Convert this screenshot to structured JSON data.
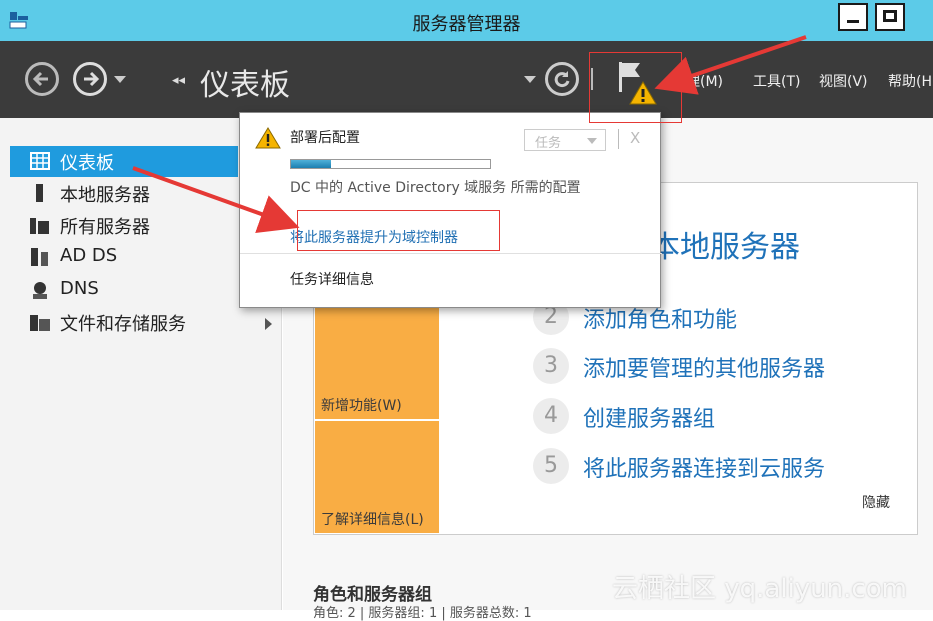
{
  "window": {
    "title": "服务器管理器"
  },
  "nav": {
    "breadcrumb": "仪表板",
    "breadcrumb_arrows": "◂◂"
  },
  "menu": {
    "manage": "管理(M)",
    "tools": "工具(T)",
    "view": "视图(V)",
    "help": "帮助(H"
  },
  "sidebar": {
    "items": [
      {
        "label": "仪表板",
        "icon": "dashboard-icon",
        "active": true
      },
      {
        "label": "本地服务器",
        "icon": "local-server-icon"
      },
      {
        "label": "所有服务器",
        "icon": "all-servers-icon"
      },
      {
        "label": "AD DS",
        "icon": "ad-ds-icon"
      },
      {
        "label": "DNS",
        "icon": "dns-icon"
      },
      {
        "label": "文件和存储服务",
        "icon": "file-storage-icon"
      }
    ]
  },
  "popup": {
    "title": "部署后配置",
    "progress": 0.2,
    "description": "DC 中的 Active Directory 域服务 所需的配置",
    "link": "将此服务器提升为域控制器",
    "details": "任务详细信息",
    "tasks_label": "任务",
    "close": "X"
  },
  "welcome": {
    "heading": "本地服务器",
    "tiles": [
      {
        "label": "新增功能(W)"
      },
      {
        "label": "了解详细信息(L)"
      }
    ],
    "steps": [
      {
        "num": "2",
        "text": "添加角色和功能"
      },
      {
        "num": "3",
        "text": "添加要管理的其他服务器"
      },
      {
        "num": "4",
        "text": "创建服务器组"
      },
      {
        "num": "5",
        "text": "将此服务器连接到云服务"
      }
    ],
    "hide": "隐藏"
  },
  "roles": {
    "title": "角色和服务器组",
    "subtitle": "角色: 2 | 服务器组: 1 | 服务器总数: 1"
  },
  "watermark": "云栖社区 yq.aliyun.com",
  "colors": {
    "accent": "#1f9bde",
    "titlebar": "#5ccbe8",
    "navbar": "#3b3b3b",
    "tile": "#f9ad44",
    "warning": "#f5b400",
    "annotation": "#e53935"
  }
}
